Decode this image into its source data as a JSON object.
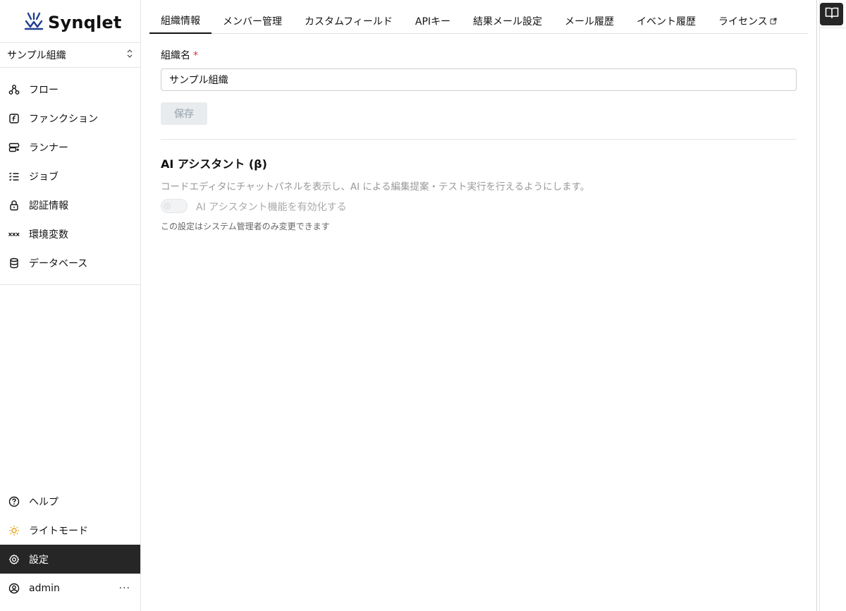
{
  "brand": {
    "name": "Synqlet"
  },
  "org_selector": {
    "value": "サンプル組織"
  },
  "sidebar": {
    "items": [
      {
        "label": "フロー",
        "icon": "flow-icon"
      },
      {
        "label": "ファンクション",
        "icon": "function-icon"
      },
      {
        "label": "ランナー",
        "icon": "runner-icon"
      },
      {
        "label": "ジョブ",
        "icon": "job-list-icon"
      },
      {
        "label": "認証情報",
        "icon": "lock-icon"
      },
      {
        "label": "環境変数",
        "icon": "variable-icon"
      },
      {
        "label": "データベース",
        "icon": "database-icon"
      }
    ],
    "bottom": [
      {
        "label": "ヘルプ",
        "icon": "help-icon"
      },
      {
        "label": "ライトモード",
        "icon": "sun-icon"
      },
      {
        "label": "設定",
        "icon": "gear-icon",
        "active": true
      },
      {
        "label": "admin",
        "icon": "user-icon",
        "more": "···"
      }
    ]
  },
  "tabs": [
    {
      "label": "組織情報",
      "active": true
    },
    {
      "label": "メンバー管理"
    },
    {
      "label": "カスタムフィールド"
    },
    {
      "label": "APIキー"
    },
    {
      "label": "結果メール設定"
    },
    {
      "label": "メール履歴"
    },
    {
      "label": "イベント履歴"
    },
    {
      "label": "ライセンス",
      "external": true
    }
  ],
  "form": {
    "org_name_label": "組織名",
    "required_mark": "*",
    "org_name_value": "サンプル組織",
    "save_label": "保存"
  },
  "ai": {
    "title": "AI アシスタント (β)",
    "description": "コードエディタにチャットパネルを表示し、AI による編集提案・テスト実行を行えるようにします。",
    "toggle_label": "AI アシスタント機能を有効化する",
    "toggle_enabled": false,
    "note": "この設定はシステム管理者のみ変更できます"
  },
  "colors": {
    "active_bg": "#262626",
    "required": "#e03131",
    "brand": "#1f3f8f"
  }
}
